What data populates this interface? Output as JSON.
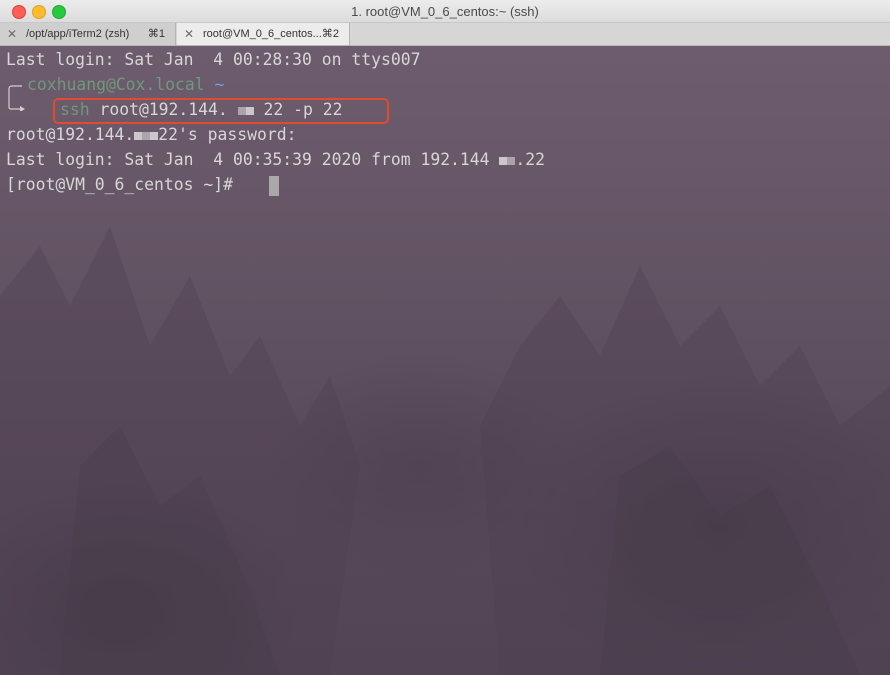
{
  "window": {
    "title": "1. root@VM_0_6_centos:~ (ssh)"
  },
  "tabs": [
    {
      "label": "/opt/app/iTerm2 (zsh)",
      "shortcut": "⌘1",
      "close": "✕"
    },
    {
      "label": "root@VM_0_6_centos...",
      "shortcut": "⌘2",
      "close": "✕"
    }
  ],
  "terminal": {
    "line1": "Last login: Sat Jan  4 00:28:30 on ttys007",
    "prompt_user": "coxhuang@Cox.local",
    "prompt_dir": "~",
    "cmd_ssh": "ssh",
    "cmd_host_prefix": " root@192.144.",
    "cmd_host_suffix": "22",
    "cmd_flag": " -p 22",
    "pw_prefix": "root@192.144.",
    "pw_suffix": "22's password:",
    "last_login_prefix": "Last login: Sat Jan  4 00:35:39 2020 from 192.144 ",
    "last_login_suffix": ".22",
    "shell_prompt": "[root@VM_0_6_centos ~]#"
  },
  "colors": {
    "highlight_box": "#e44b2e",
    "prompt_green": "#6d9a78",
    "prompt_blue": "#6aa4d8"
  }
}
